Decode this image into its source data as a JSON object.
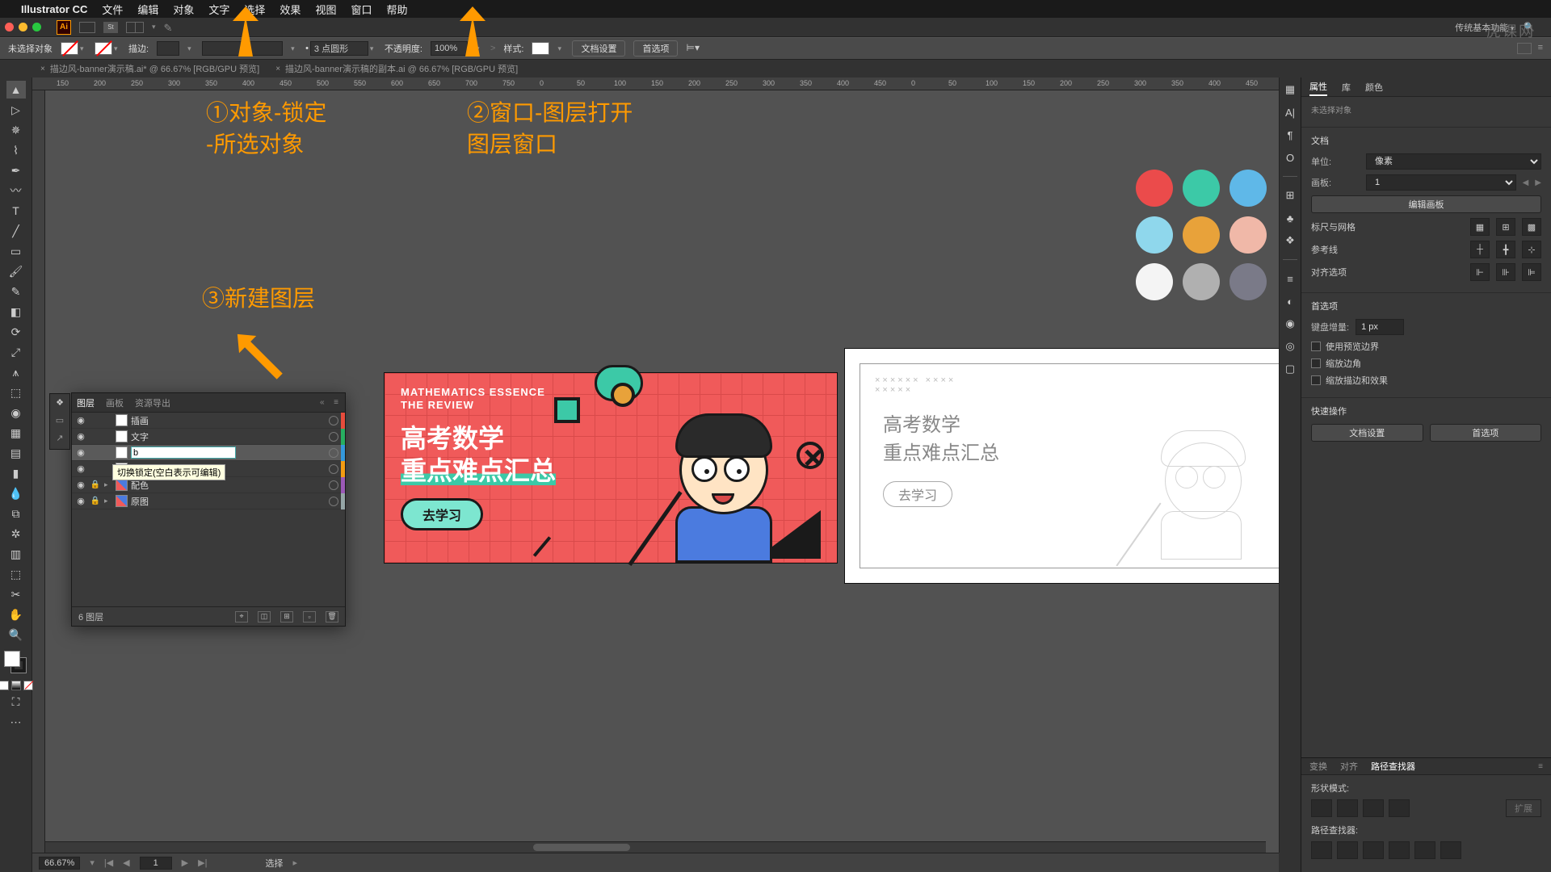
{
  "menubar": {
    "app": "Illustrator CC",
    "items": [
      "文件",
      "编辑",
      "对象",
      "文字",
      "选择",
      "效果",
      "视图",
      "窗口",
      "帮助"
    ]
  },
  "appbar": {
    "workspace": "传统基本功能",
    "search_placeholder": "搜索"
  },
  "watermark": "虎课网",
  "controlbar": {
    "no_selection": "未选择对象",
    "stroke_label": "描边:",
    "stroke_weight": "",
    "stroke_profile": "3 点圆形",
    "opacity_label": "不透明度:",
    "opacity_value": "100%",
    "style_label": "样式:",
    "doc_setup": "文档设置",
    "prefs": "首选项"
  },
  "tabs": [
    {
      "name": "描边风-banner演示稿.ai* @ 66.67% [RGB/GPU 预览]"
    },
    {
      "name": "描边风-banner演示稿的副本.ai @ 66.67% [RGB/GPU 预览]"
    }
  ],
  "ruler_marks": [
    "150",
    "200",
    "250",
    "300",
    "350",
    "400",
    "450",
    "500",
    "550",
    "600",
    "650",
    "700",
    "750",
    "0",
    "50",
    "100",
    "150",
    "200",
    "250",
    "300",
    "350",
    "400",
    "450",
    "0",
    "50",
    "100",
    "150",
    "200",
    "250",
    "300",
    "350",
    "400",
    "450"
  ],
  "annotations": {
    "a1_l1": "①对象-锁定",
    "a1_l2": "-所选对象",
    "a2_l1": "②窗口-图层打开",
    "a2_l2": "图层窗口",
    "a3": "③新建图层"
  },
  "palette": [
    "#eb4b4b",
    "#3cc9a7",
    "#5fb8e8",
    "#8fd7ec",
    "#e8a23a",
    "#f0b8a8",
    "#f4f4f4",
    "#b0b0b0",
    "#7a7a88"
  ],
  "banner": {
    "sub1": "MATHEMATICS ESSENCE",
    "sub2": "THE REVIEW",
    "title1": "高考数学",
    "title2": "重点难点汇总",
    "cta": "去学习"
  },
  "sketch": {
    "l1": "高考数学",
    "l2": "重点难点汇总",
    "cta": "去学习"
  },
  "layers_panel": {
    "tabs": [
      "图层",
      "画板",
      "资源导出"
    ],
    "layers": [
      {
        "name": "插画",
        "vis": true,
        "lock": false,
        "color": "#e74c3c"
      },
      {
        "name": "文字",
        "vis": true,
        "lock": false,
        "color": "#27ae60"
      },
      {
        "name": "",
        "editing": true,
        "value": "b",
        "vis": true,
        "lock": false,
        "color": "#3498db",
        "selected": true
      },
      {
        "name": "",
        "vis": true,
        "lock": false,
        "color": "#f39c12"
      },
      {
        "name": "配色",
        "vis": true,
        "lock": true,
        "expand": true,
        "thumb": true,
        "color": "#9b59b6"
      },
      {
        "name": "原图",
        "vis": true,
        "lock": true,
        "expand": true,
        "thumb": true,
        "color": "#95a5a6"
      }
    ],
    "tooltip": "切换锁定(空白表示可编辑)",
    "footer_count": "6 图层"
  },
  "properties": {
    "tabs": [
      "属性",
      "库",
      "颜色"
    ],
    "no_selection": "未选择对象",
    "doc_section": "文档",
    "units_label": "单位:",
    "units_value": "像素",
    "artboard_label": "画板:",
    "artboard_value": "1",
    "edit_artboards": "编辑画板",
    "rulers_grid": "标尺与网格",
    "guides": "参考线",
    "align_options": "对齐选项",
    "prefs_section": "首选项",
    "key_increment_label": "键盘增量:",
    "key_increment_value": "1 px",
    "chk1": "使用预览边界",
    "chk2": "缩放边角",
    "chk3": "缩放描边和效果",
    "quick_actions": "快速操作",
    "btn_doc_setup": "文档设置",
    "btn_prefs": "首选项"
  },
  "pathfinder": {
    "tabs": [
      "变换",
      "对齐",
      "路径查找器"
    ],
    "shape_modes": "形状模式:",
    "expand": "扩展",
    "pathfinders": "路径查找器:"
  },
  "statusbar": {
    "zoom": "66.67%",
    "tool": "选择"
  }
}
